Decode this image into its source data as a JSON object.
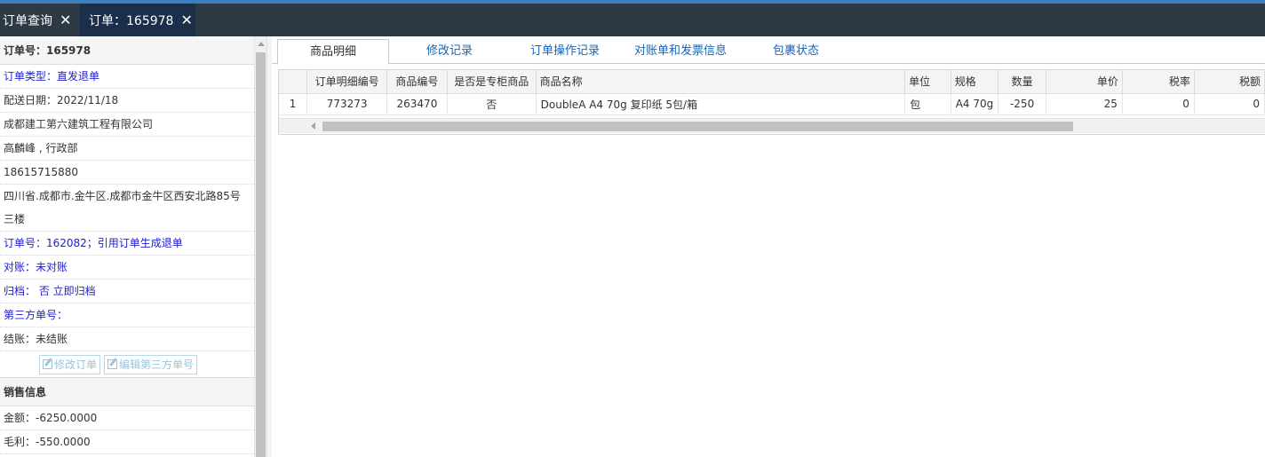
{
  "tabs": [
    {
      "label": "订单查询",
      "close": "✕"
    },
    {
      "label": "订单：165978",
      "close": "✕"
    }
  ],
  "left": {
    "order_header": "订单号：165978",
    "order_type": "订单类型：直发退单",
    "delivery_date": "配送日期：2022/11/18",
    "company": "成都建工第六建筑工程有限公司",
    "contact": "高麟峰 , 行政部",
    "phone": "18615715880",
    "address": "四川省.成都市.金牛区.成都市金牛区西安北路85号三楼",
    "ref_order": "订单号：162082；引用订单生成退单",
    "reconcile": "对账：未对账",
    "archive": "归档：  否 立即归档",
    "third_party": "第三方单号：",
    "settle": "结账：未结账",
    "edit_order_btn": "修改订单",
    "edit_third_btn": "编辑第三方单号",
    "sales_header": "销售信息",
    "amount": "金额：-6250.0000",
    "gross_profit": "毛利：-550.0000"
  },
  "subtabs": [
    "商品明细",
    "修改记录",
    "订单操作记录",
    "对账单和发票信息",
    "包裹状态"
  ],
  "grid": {
    "columns": [
      "",
      "订单明细编号",
      "商品编号",
      "是否是专柜商品",
      "商品名称",
      "单位",
      "规格",
      "数量",
      "单价",
      "税率",
      "税额"
    ],
    "rows": [
      [
        "1",
        "773273",
        "263470",
        "否",
        "DoubleA A4 70g 复印纸 5包/箱",
        "包",
        "A4 70g",
        "-250",
        "25",
        "0",
        "0"
      ]
    ]
  }
}
